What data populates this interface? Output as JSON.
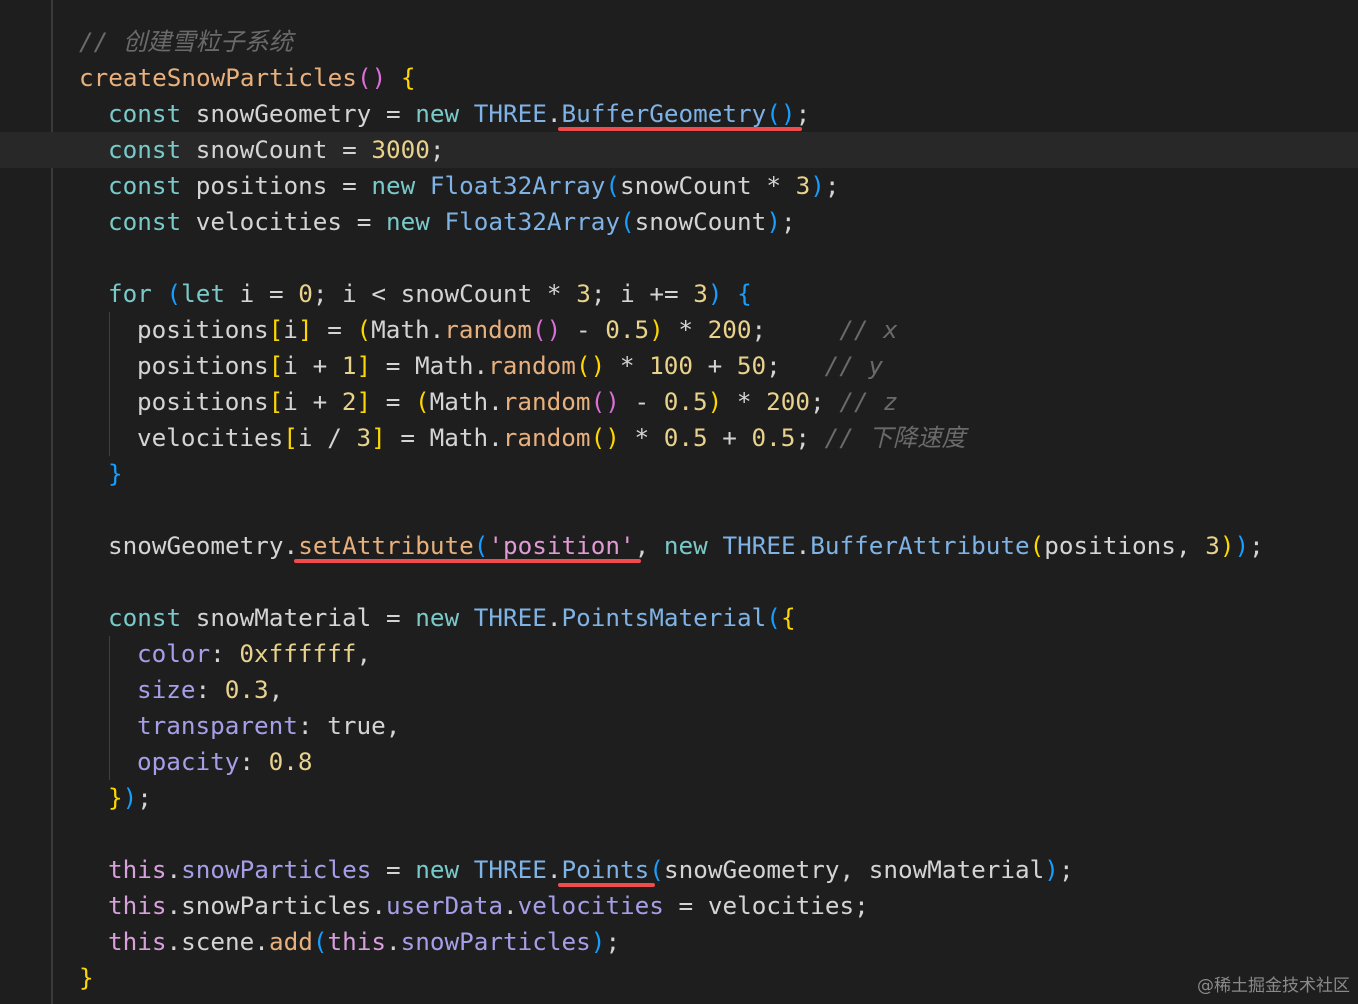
{
  "colors": {
    "background": "#1e1e1e",
    "current_line": "#282828",
    "highlight_underline": "#f14c4c",
    "comment": "#6a6a6a",
    "function": "#e8b07c",
    "keyword": "#7ac9c9",
    "class": "#7fb2e5",
    "number": "#e9d28c",
    "property": "#a69fe8",
    "string": "#e09ad4"
  },
  "watermark": "@稀土掘金技术社区",
  "lines": [
    {
      "indent": 0,
      "tokens": [
        [
          "com",
          "// 创建雪粒子系统"
        ]
      ]
    },
    {
      "indent": 0,
      "tokens": [
        [
          "fn",
          "createSnowParticles"
        ],
        [
          "b2",
          "()"
        ],
        [
          "pun",
          " "
        ],
        [
          "b1",
          "{"
        ]
      ]
    },
    {
      "indent": 1,
      "tokens": [
        [
          "kw",
          "const"
        ],
        [
          "var",
          " snowGeometry "
        ],
        [
          "pun",
          "= "
        ],
        [
          "kw",
          "new "
        ],
        [
          "cls",
          "THREE"
        ],
        [
          "pun",
          "."
        ],
        [
          "cls",
          "BufferGeometry"
        ],
        [
          "b3",
          "()"
        ],
        [
          "pun",
          ";"
        ]
      ]
    },
    {
      "indent": 1,
      "tokens": [
        [
          "kw",
          "const"
        ],
        [
          "var",
          " snowCount "
        ],
        [
          "pun",
          "= "
        ],
        [
          "num",
          "3000"
        ],
        [
          "pun",
          ";"
        ]
      ]
    },
    {
      "indent": 1,
      "tokens": [
        [
          "kw",
          "const"
        ],
        [
          "var",
          " positions "
        ],
        [
          "pun",
          "= "
        ],
        [
          "kw",
          "new "
        ],
        [
          "cls",
          "Float32Array"
        ],
        [
          "b3",
          "("
        ],
        [
          "var",
          "snowCount "
        ],
        [
          "pun",
          "* "
        ],
        [
          "num",
          "3"
        ],
        [
          "b3",
          ")"
        ],
        [
          "pun",
          ";"
        ]
      ]
    },
    {
      "indent": 1,
      "tokens": [
        [
          "kw",
          "const"
        ],
        [
          "var",
          " velocities "
        ],
        [
          "pun",
          "= "
        ],
        [
          "kw",
          "new "
        ],
        [
          "cls",
          "Float32Array"
        ],
        [
          "b3",
          "("
        ],
        [
          "var",
          "snowCount"
        ],
        [
          "b3",
          ")"
        ],
        [
          "pun",
          ";"
        ]
      ]
    },
    {
      "indent": 0,
      "tokens": []
    },
    {
      "indent": 1,
      "tokens": [
        [
          "kw",
          "for "
        ],
        [
          "b3",
          "("
        ],
        [
          "kw",
          "let"
        ],
        [
          "var",
          " i "
        ],
        [
          "pun",
          "= "
        ],
        [
          "num",
          "0"
        ],
        [
          "pun",
          "; "
        ],
        [
          "var",
          "i "
        ],
        [
          "pun",
          "< "
        ],
        [
          "var",
          "snowCount "
        ],
        [
          "pun",
          "* "
        ],
        [
          "num",
          "3"
        ],
        [
          "pun",
          "; "
        ],
        [
          "var",
          "i "
        ],
        [
          "pun",
          "+= "
        ],
        [
          "num",
          "3"
        ],
        [
          "b3",
          ")"
        ],
        [
          "pun",
          " "
        ],
        [
          "b3",
          "{"
        ]
      ]
    },
    {
      "indent": 2,
      "tokens": [
        [
          "var",
          "positions"
        ],
        [
          "b1",
          "["
        ],
        [
          "var",
          "i"
        ],
        [
          "b1",
          "]"
        ],
        [
          "pun",
          " = "
        ],
        [
          "b1",
          "("
        ],
        [
          "var",
          "Math"
        ],
        [
          "pun",
          "."
        ],
        [
          "fn",
          "random"
        ],
        [
          "b2",
          "()"
        ],
        [
          "pun",
          " - "
        ],
        [
          "num",
          "0.5"
        ],
        [
          "b1",
          ")"
        ],
        [
          "pun",
          " * "
        ],
        [
          "num",
          "200"
        ],
        [
          "pun",
          ";     "
        ],
        [
          "com",
          "// x"
        ]
      ]
    },
    {
      "indent": 2,
      "tokens": [
        [
          "var",
          "positions"
        ],
        [
          "b1",
          "["
        ],
        [
          "var",
          "i "
        ],
        [
          "pun",
          "+ "
        ],
        [
          "num",
          "1"
        ],
        [
          "b1",
          "]"
        ],
        [
          "pun",
          " = "
        ],
        [
          "var",
          "Math"
        ],
        [
          "pun",
          "."
        ],
        [
          "fn",
          "random"
        ],
        [
          "b1",
          "()"
        ],
        [
          "pun",
          " * "
        ],
        [
          "num",
          "100"
        ],
        [
          "pun",
          " + "
        ],
        [
          "num",
          "50"
        ],
        [
          "pun",
          ";   "
        ],
        [
          "com",
          "// y"
        ]
      ]
    },
    {
      "indent": 2,
      "tokens": [
        [
          "var",
          "positions"
        ],
        [
          "b1",
          "["
        ],
        [
          "var",
          "i "
        ],
        [
          "pun",
          "+ "
        ],
        [
          "num",
          "2"
        ],
        [
          "b1",
          "]"
        ],
        [
          "pun",
          " = "
        ],
        [
          "b1",
          "("
        ],
        [
          "var",
          "Math"
        ],
        [
          "pun",
          "."
        ],
        [
          "fn",
          "random"
        ],
        [
          "b2",
          "()"
        ],
        [
          "pun",
          " - "
        ],
        [
          "num",
          "0.5"
        ],
        [
          "b1",
          ")"
        ],
        [
          "pun",
          " * "
        ],
        [
          "num",
          "200"
        ],
        [
          "pun",
          "; "
        ],
        [
          "com",
          "// z"
        ]
      ]
    },
    {
      "indent": 2,
      "tokens": [
        [
          "var",
          "velocities"
        ],
        [
          "b1",
          "["
        ],
        [
          "var",
          "i "
        ],
        [
          "pun",
          "/ "
        ],
        [
          "num",
          "3"
        ],
        [
          "b1",
          "]"
        ],
        [
          "pun",
          " = "
        ],
        [
          "var",
          "Math"
        ],
        [
          "pun",
          "."
        ],
        [
          "fn",
          "random"
        ],
        [
          "b1",
          "()"
        ],
        [
          "pun",
          " * "
        ],
        [
          "num",
          "0.5"
        ],
        [
          "pun",
          " + "
        ],
        [
          "num",
          "0.5"
        ],
        [
          "pun",
          "; "
        ],
        [
          "com",
          "// 下降速度"
        ]
      ]
    },
    {
      "indent": 1,
      "tokens": [
        [
          "b3",
          "}"
        ]
      ]
    },
    {
      "indent": 0,
      "tokens": []
    },
    {
      "indent": 1,
      "tokens": [
        [
          "var",
          "snowGeometry"
        ],
        [
          "pun",
          "."
        ],
        [
          "fn",
          "setAttribute"
        ],
        [
          "b3",
          "("
        ],
        [
          "str",
          "'position'"
        ],
        [
          "pun",
          ", "
        ],
        [
          "kw",
          "new "
        ],
        [
          "cls",
          "THREE"
        ],
        [
          "pun",
          "."
        ],
        [
          "cls",
          "BufferAttribute"
        ],
        [
          "b1",
          "("
        ],
        [
          "var",
          "positions"
        ],
        [
          "pun",
          ", "
        ],
        [
          "num",
          "3"
        ],
        [
          "b1",
          ")"
        ],
        [
          "b3",
          ")"
        ],
        [
          "pun",
          ";"
        ]
      ]
    },
    {
      "indent": 0,
      "tokens": []
    },
    {
      "indent": 1,
      "tokens": [
        [
          "kw",
          "const"
        ],
        [
          "var",
          " snowMaterial "
        ],
        [
          "pun",
          "= "
        ],
        [
          "kw",
          "new "
        ],
        [
          "cls",
          "THREE"
        ],
        [
          "pun",
          "."
        ],
        [
          "cls",
          "PointsMaterial"
        ],
        [
          "b3",
          "("
        ],
        [
          "b1",
          "{"
        ]
      ]
    },
    {
      "indent": 2,
      "tokens": [
        [
          "prop",
          "color"
        ],
        [
          "pun",
          ": "
        ],
        [
          "num",
          "0xffffff"
        ],
        [
          "pun",
          ","
        ]
      ]
    },
    {
      "indent": 2,
      "tokens": [
        [
          "prop",
          "size"
        ],
        [
          "pun",
          ": "
        ],
        [
          "num",
          "0.3"
        ],
        [
          "pun",
          ","
        ]
      ]
    },
    {
      "indent": 2,
      "tokens": [
        [
          "prop",
          "transparent"
        ],
        [
          "pun",
          ": "
        ],
        [
          "var",
          "true"
        ],
        [
          "pun",
          ","
        ]
      ]
    },
    {
      "indent": 2,
      "tokens": [
        [
          "prop",
          "opacity"
        ],
        [
          "pun",
          ": "
        ],
        [
          "num",
          "0.8"
        ]
      ]
    },
    {
      "indent": 1,
      "tokens": [
        [
          "b1",
          "}"
        ],
        [
          "b3",
          ")"
        ],
        [
          "pun",
          ";"
        ]
      ]
    },
    {
      "indent": 0,
      "tokens": []
    },
    {
      "indent": 1,
      "tokens": [
        [
          "this",
          "this"
        ],
        [
          "pun",
          "."
        ],
        [
          "prop",
          "snowParticles"
        ],
        [
          "pun",
          " = "
        ],
        [
          "kw",
          "new "
        ],
        [
          "cls",
          "THREE"
        ],
        [
          "pun",
          "."
        ],
        [
          "cls",
          "Points"
        ],
        [
          "b3",
          "("
        ],
        [
          "var",
          "snowGeometry"
        ],
        [
          "pun",
          ", "
        ],
        [
          "var",
          "snowMaterial"
        ],
        [
          "b3",
          ")"
        ],
        [
          "pun",
          ";"
        ]
      ]
    },
    {
      "indent": 1,
      "tokens": [
        [
          "this",
          "this"
        ],
        [
          "pun",
          "."
        ],
        [
          "var",
          "snowParticles"
        ],
        [
          "pun",
          "."
        ],
        [
          "prop",
          "userData"
        ],
        [
          "pun",
          "."
        ],
        [
          "prop",
          "velocities"
        ],
        [
          "pun",
          " = "
        ],
        [
          "var",
          "velocities"
        ],
        [
          "pun",
          ";"
        ]
      ]
    },
    {
      "indent": 1,
      "tokens": [
        [
          "this",
          "this"
        ],
        [
          "pun",
          "."
        ],
        [
          "var",
          "scene"
        ],
        [
          "pun",
          "."
        ],
        [
          "fn",
          "add"
        ],
        [
          "b3",
          "("
        ],
        [
          "this",
          "this"
        ],
        [
          "pun",
          "."
        ],
        [
          "prop",
          "snowParticles"
        ],
        [
          "b3",
          ")"
        ],
        [
          "pun",
          ";"
        ]
      ]
    },
    {
      "indent": 0,
      "tokens": [
        [
          "b1",
          "}"
        ]
      ]
    }
  ],
  "current_line_index": 3,
  "underlines": [
    {
      "line": 2,
      "from": "BufferGeometry",
      "to": "()"
    },
    {
      "line": 14,
      "from": "setAttribute",
      "to": "'position'"
    },
    {
      "line": 23,
      "from": "Points",
      "to": "Points"
    }
  ]
}
